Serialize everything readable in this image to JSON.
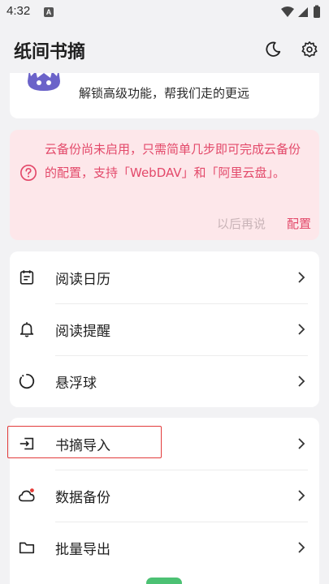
{
  "status_bar": {
    "time": "4:32",
    "notif_badge": "A"
  },
  "app_bar": {
    "title": "纸间书摘",
    "icons": [
      "moon-icon",
      "gear-icon"
    ]
  },
  "promo": {
    "text": "解锁高级功能，帮我们走的更远"
  },
  "backup_alert": {
    "message": "云备份尚未启用，只需简单几步即可完成云备份的配置，支持「WebDAV」和「阿里云盘」。",
    "later_label": "以后再说",
    "config_label": "配置",
    "accent": "#e3496a"
  },
  "menu_group_1": [
    {
      "label": "阅读日历",
      "icon": "calendar-icon"
    },
    {
      "label": "阅读提醒",
      "icon": "bell-icon"
    },
    {
      "label": "悬浮球",
      "icon": "floating-ball-icon"
    }
  ],
  "menu_group_2": [
    {
      "label": "书摘导入",
      "icon": "import-icon"
    },
    {
      "label": "数据备份",
      "icon": "cloud-icon"
    },
    {
      "label": "批量导出",
      "icon": "folder-icon"
    }
  ]
}
